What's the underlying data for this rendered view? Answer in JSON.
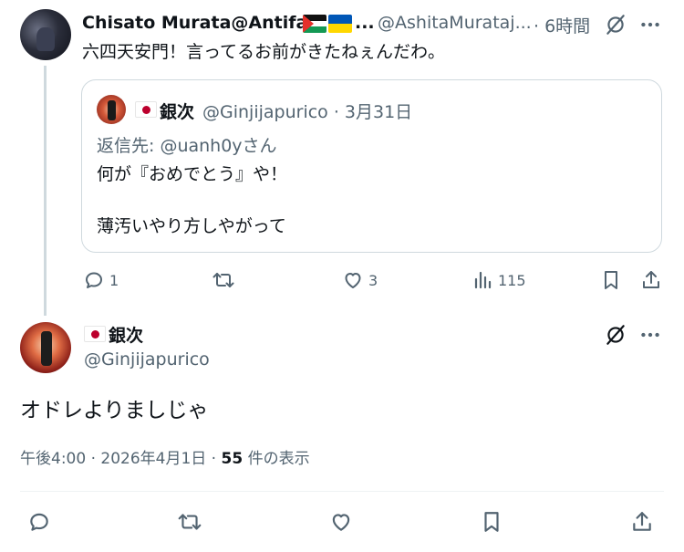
{
  "parent_tweet": {
    "display_name": "Chisato Murata@Antifa",
    "name_ellipsis": "...",
    "handle": "@AshitaMurataj...",
    "time": "· 6時間",
    "text": "六四天安門！言ってるお前がきたねぇんだわ。",
    "flags": [
      "palestine-flag",
      "ukraine-flag"
    ],
    "quote": {
      "display_name": "銀次",
      "handle_time": "@Ginjijapurico · 3月31日",
      "reply_to": "返信先: @uanh0yさん",
      "line1": "何が『おめでとう』や！",
      "line2": "薄汚いやり方しやがって"
    },
    "actions": {
      "replies": "1",
      "retweets": "",
      "likes": "3",
      "views": "115"
    }
  },
  "main_tweet": {
    "display_name": "銀次",
    "handle": "@Ginjijapurico",
    "text": "オドレよりましじゃ",
    "meta_prefix": "午後4:00 · 2026年4月1日 · ",
    "views_count": "55",
    "views_suffix": " 件の表示"
  },
  "colors": {
    "text": "#0f1419",
    "muted": "#536471",
    "border": "#cfd9de",
    "divider": "#eff3f4"
  }
}
